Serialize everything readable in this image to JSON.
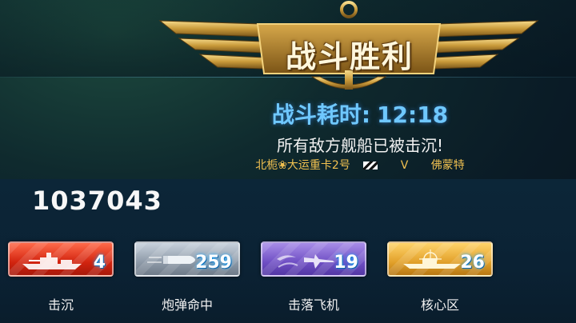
{
  "header": {
    "title": "战斗胜利"
  },
  "battle": {
    "duration_label": "战斗耗时:",
    "duration_value": "12:18",
    "result_message": "所有敌方舰船已被击沉!",
    "player_ship": "北栀❀大运重卡2号",
    "vs_label": "V",
    "enemy_name": "佛蒙特"
  },
  "score": {
    "value": "1037043"
  },
  "stats": [
    {
      "label": "击沉",
      "value": "4",
      "icon": "warship-icon",
      "color": "#d2240f"
    },
    {
      "label": "炮弹命中",
      "value": "259",
      "icon": "shell-icon",
      "color": "#8e9aa8"
    },
    {
      "label": "击落飞机",
      "value": "19",
      "icon": "aircraft-icon",
      "color": "#6f4fc4"
    },
    {
      "label": "核心区",
      "value": "26",
      "icon": "crosshair-ship-icon",
      "color": "#e2a12a"
    }
  ],
  "colors": {
    "accent_blue": "#6fc8ff",
    "gold": "#f0c050"
  }
}
